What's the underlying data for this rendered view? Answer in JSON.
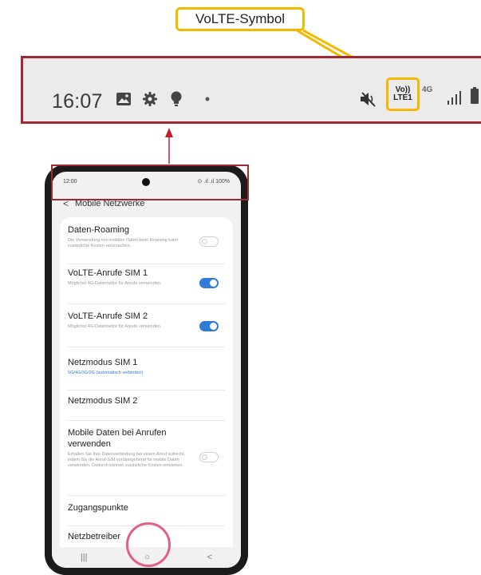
{
  "callout": {
    "label": "VoLTE-Symbol"
  },
  "zoom_bar": {
    "time": "16:07",
    "volte_line1": "Vo))",
    "volte_line2": "LTE1",
    "network": "4G"
  },
  "phone": {
    "status_time": "12:00",
    "status_right": "⊙ .ıl .ıl 100%",
    "header_title": "Mobile Netzwerke",
    "rows": [
      {
        "title": "Daten-Roaming",
        "sub": "Die Verwendung von mobilen Daten beim Roaming kann zusätzliche Kosten verursachen.",
        "toggle": "off"
      },
      {
        "title": "VoLTE-Anrufe SIM 1",
        "sub": "Möglichst 4G-Datennetze für Anrufe verwenden.",
        "toggle": "on"
      },
      {
        "title": "VoLTE-Anrufe SIM 2",
        "sub": "Möglichst 4G-Datennetze für Anrufe verwenden.",
        "toggle": "on"
      },
      {
        "title": "Netzmodus SIM 1",
        "sub": "5G/4G/3G/2G (automatisch verbinden)",
        "toggle": ""
      },
      {
        "title": "Netzmodus SIM 2",
        "sub": "",
        "toggle": ""
      },
      {
        "title": "Mobile Daten bei Anrufen verwenden",
        "sub": "Erhalten Sie Ihre Datenverbindung bei einem Anruf aufrecht, indem Sie die Anruf-SIM vorübergehend für mobile Daten verwenden. Dadurch können zusätzliche Kosten entstehen.",
        "toggle": "off"
      },
      {
        "title": "Zugangspunkte",
        "sub": "",
        "toggle": ""
      },
      {
        "title": "Netzbetreiber",
        "sub": "",
        "toggle": ""
      }
    ],
    "nav": {
      "recents": "|||",
      "home": "○",
      "back": "<"
    }
  },
  "colors": {
    "highlight": "#f5b800",
    "frame": "#9e2a32",
    "home_circle": "#e05e8c",
    "toggle_on": "#2f7bd8"
  }
}
